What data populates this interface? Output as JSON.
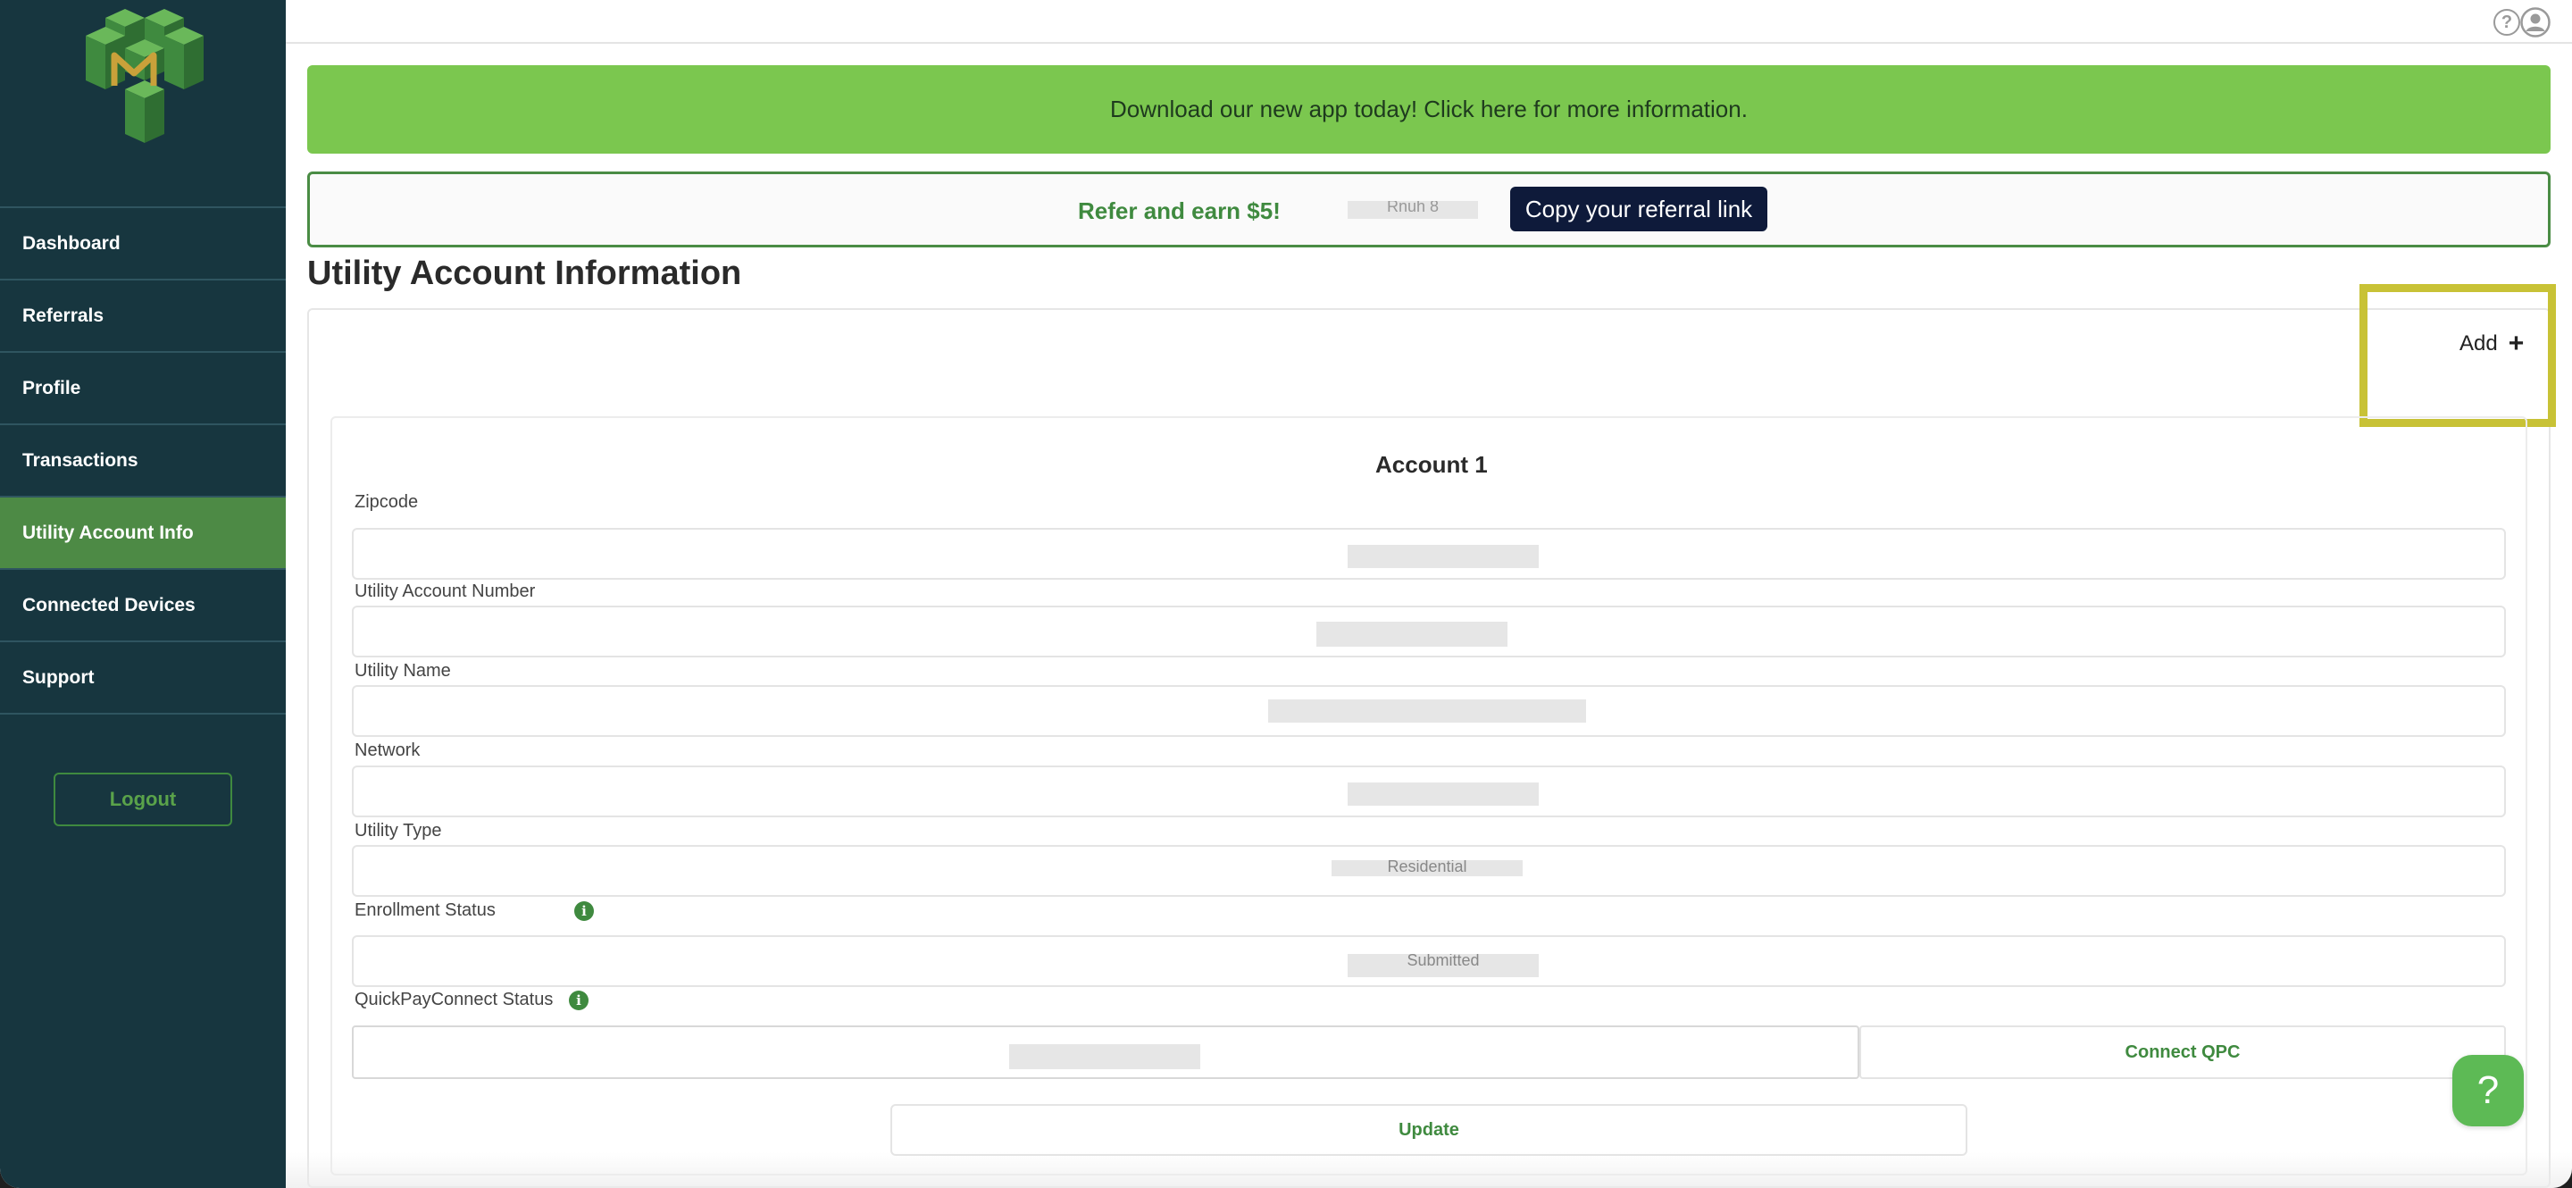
{
  "sidebar": {
    "logo_icon": "cube-m-logo-icon",
    "items": [
      {
        "label": "Dashboard",
        "active": false
      },
      {
        "label": "Referrals",
        "active": false
      },
      {
        "label": "Profile",
        "active": false
      },
      {
        "label": "Transactions",
        "active": false
      },
      {
        "label": "Utility Account Info",
        "active": true
      },
      {
        "label": "Connected Devices",
        "active": false
      },
      {
        "label": "Support",
        "active": false
      }
    ],
    "logout_label": "Logout"
  },
  "topbar": {
    "help_icon": "question-circle-icon",
    "help_glyph": "?",
    "user_icon": "user-circle-icon"
  },
  "app_banner": {
    "text": "Download our new app today! Click here for more information."
  },
  "referral": {
    "text": "Refer and earn $5!",
    "code_partial": "Rnuh 8",
    "copy_label": "Copy your referral link"
  },
  "page": {
    "title": "Utility Account Information",
    "add_label": "Add",
    "add_glyph": "+"
  },
  "account": {
    "title": "Account 1",
    "fields": {
      "zipcode": {
        "label": "Zipcode"
      },
      "account_number": {
        "label": "Utility Account Number"
      },
      "utility_name": {
        "label": "Utility Name"
      },
      "network": {
        "label": "Network"
      },
      "utility_type": {
        "label": "Utility Type",
        "value_partial": "Residential"
      },
      "enrollment_status": {
        "label": "Enrollment Status",
        "value_partial": "Submitted"
      },
      "qpc_status": {
        "label": "QuickPayConnect Status"
      }
    },
    "info_glyph": "i",
    "connect_label": "Connect QPC",
    "update_label": "Update"
  },
  "help_fab": {
    "icon": "question-mark-icon",
    "glyph": "?"
  },
  "colors": {
    "sidebar_bg": "#17363f",
    "active_nav": "#4d8a45",
    "banner_green": "#7bc74f",
    "brand_green": "#3f8a3f",
    "copy_button": "#0e1a3a",
    "highlight": "#c8c236",
    "logo_green": "#5aa34a",
    "logo_gold": "#c9a13a"
  }
}
